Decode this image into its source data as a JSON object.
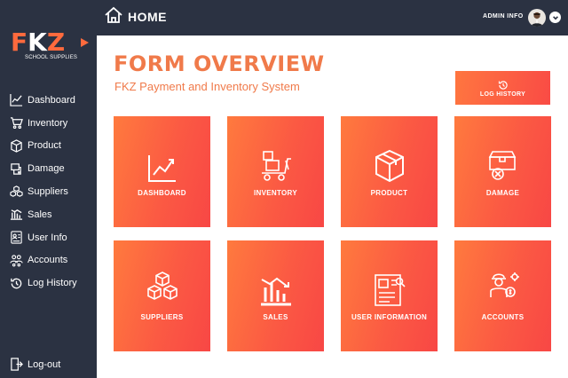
{
  "sidebar": {
    "logo": {
      "text_f": "F",
      "text_k": "K",
      "text_z": "Z",
      "subtitle": "SCHOOL SUPPLIES"
    },
    "items": [
      {
        "label": "Dashboard",
        "icon": "chart-line-icon"
      },
      {
        "label": "Inventory",
        "icon": "cart-icon"
      },
      {
        "label": "Product",
        "icon": "box-icon"
      },
      {
        "label": "Damage",
        "icon": "damage-box-icon"
      },
      {
        "label": "Suppliers",
        "icon": "stacked-boxes-icon"
      },
      {
        "label": "Sales",
        "icon": "bar-chart-icon"
      },
      {
        "label": "User Info",
        "icon": "id-card-icon"
      },
      {
        "label": "Accounts",
        "icon": "users-icon"
      },
      {
        "label": "Log History",
        "icon": "history-icon"
      }
    ],
    "logout_label": "Log-out"
  },
  "header": {
    "title": "HOME",
    "user_label": "ADMIN INFO"
  },
  "main": {
    "title": "FORM OVERVIEW",
    "subtitle": "FKZ Payment and Inventory System",
    "log_history_button": "LOG HISTORY",
    "tiles": [
      {
        "label": "DASHBOARD",
        "icon": "chart-line-icon"
      },
      {
        "label": "INVENTORY",
        "icon": "trolley-icon"
      },
      {
        "label": "PRODUCT",
        "icon": "box-icon"
      },
      {
        "label": "DAMAGE",
        "icon": "damage-box-icon"
      },
      {
        "label": "SUPPLIERS",
        "icon": "stacked-boxes-icon"
      },
      {
        "label": "SALES",
        "icon": "bar-chart-icon"
      },
      {
        "label": "USER INFORMATION",
        "icon": "id-card-icon"
      },
      {
        "label": "ACCOUNTS",
        "icon": "worker-icon"
      }
    ]
  },
  "colors": {
    "sidebar_bg": "#2b3242",
    "accent": "#f07a4a",
    "tile_start": "#ff7a3e",
    "tile_end": "#f84745"
  }
}
